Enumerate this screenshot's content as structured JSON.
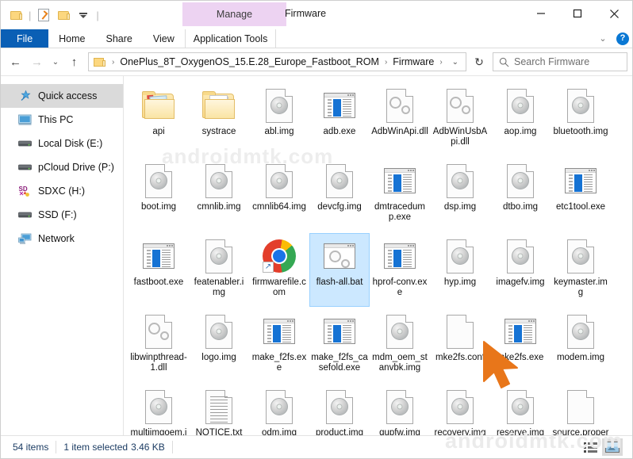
{
  "window": {
    "title": "Firmware",
    "context_tab": "Manage",
    "minimize_label": "Minimize",
    "maximize_label": "Maximize",
    "close_label": "Close"
  },
  "quick_access_toolbar": {
    "items": [
      {
        "name": "folder-icon",
        "label": "Customize Quick Access Toolbar"
      },
      {
        "name": "properties-icon",
        "label": "Properties"
      },
      {
        "name": "new-folder-icon",
        "label": "New folder"
      },
      {
        "name": "dropdown-icon",
        "label": "Customize"
      }
    ]
  },
  "ribbon": {
    "tabs": [
      {
        "label": "File",
        "id": "file"
      },
      {
        "label": "Home",
        "id": "home"
      },
      {
        "label": "Share",
        "id": "share"
      },
      {
        "label": "View",
        "id": "view"
      },
      {
        "label": "Application Tools",
        "id": "application-tools"
      }
    ],
    "collapse_icon": "chevron-down-icon",
    "help_icon": "?",
    "help_label": "Help"
  },
  "address_bar": {
    "back_icon": "←",
    "forward_icon": "→",
    "recent_icon": "⌄",
    "up_icon": "↑",
    "breadcrumbs": [
      "OnePlus_8T_OxygenOS_15.E.28_Europe_Fastboot_ROM",
      "Firmware"
    ],
    "breadcrumb_separator": "›",
    "dropdown_icon": "⌄",
    "refresh_icon": "↻",
    "refresh_label": "Refresh"
  },
  "search": {
    "placeholder": "Search Firmware",
    "icon": "search-icon"
  },
  "sidebar": {
    "items": [
      {
        "label": "Quick access",
        "icon": "star-pin-icon",
        "selected": true
      },
      {
        "label": "This PC",
        "icon": "monitor-icon",
        "selected": false
      },
      {
        "label": "Local Disk (E:)",
        "icon": "drive-icon",
        "selected": false
      },
      {
        "label": "pCloud Drive (P:)",
        "icon": "drive-icon",
        "selected": false
      },
      {
        "label": "SDXC (H:)",
        "icon": "sd-card-icon",
        "selected": false
      },
      {
        "label": "SSD (F:)",
        "icon": "drive-icon",
        "selected": false
      },
      {
        "label": "Network",
        "icon": "network-icon",
        "selected": false
      }
    ]
  },
  "files": [
    {
      "name": "api",
      "type": "folder-pictures",
      "selected": false
    },
    {
      "name": "systrace",
      "type": "folder-docs",
      "selected": false
    },
    {
      "name": "abl.img",
      "type": "disc",
      "selected": false
    },
    {
      "name": "adb.exe",
      "type": "app",
      "selected": false
    },
    {
      "name": "AdbWinApi.dll",
      "type": "dll",
      "selected": false
    },
    {
      "name": "AdbWinUsbApi.dll",
      "type": "dll",
      "selected": false
    },
    {
      "name": "aop.img",
      "type": "disc",
      "selected": false
    },
    {
      "name": "bluetooth.img",
      "type": "disc",
      "selected": false
    },
    {
      "name": "boot.img",
      "type": "disc",
      "selected": false
    },
    {
      "name": "cmnlib.img",
      "type": "disc",
      "selected": false
    },
    {
      "name": "cmnlib64.img",
      "type": "disc",
      "selected": false
    },
    {
      "name": "devcfg.img",
      "type": "disc",
      "selected": false
    },
    {
      "name": "dmtracedump.exe",
      "type": "app",
      "selected": false
    },
    {
      "name": "dsp.img",
      "type": "disc",
      "selected": false
    },
    {
      "name": "dtbo.img",
      "type": "disc",
      "selected": false
    },
    {
      "name": "etc1tool.exe",
      "type": "app",
      "selected": false
    },
    {
      "name": "fastboot.exe",
      "type": "app",
      "selected": false
    },
    {
      "name": "featenabler.img",
      "type": "disc",
      "selected": false
    },
    {
      "name": "firmwarefile.com",
      "type": "chrome-shortcut",
      "selected": false
    },
    {
      "name": "flash-all.bat",
      "type": "bat",
      "selected": true
    },
    {
      "name": "hprof-conv.exe",
      "type": "app",
      "selected": false
    },
    {
      "name": "hyp.img",
      "type": "disc",
      "selected": false
    },
    {
      "name": "imagefv.img",
      "type": "disc",
      "selected": false
    },
    {
      "name": "keymaster.img",
      "type": "disc",
      "selected": false
    },
    {
      "name": "libwinpthread-1.dll",
      "type": "dll",
      "selected": false
    },
    {
      "name": "logo.img",
      "type": "disc",
      "selected": false
    },
    {
      "name": "make_f2fs.exe",
      "type": "app",
      "selected": false
    },
    {
      "name": "make_f2fs_casefold.exe",
      "type": "app",
      "selected": false
    },
    {
      "name": "mdm_oem_stanvbk.img",
      "type": "disc",
      "selected": false
    },
    {
      "name": "mke2fs.conf",
      "type": "blank",
      "selected": false
    },
    {
      "name": "mke2fs.exe",
      "type": "app",
      "selected": false
    },
    {
      "name": "modem.img",
      "type": "disc",
      "selected": false
    },
    {
      "name": "multiimgoem.img",
      "type": "disc",
      "selected": false
    },
    {
      "name": "NOTICE.txt",
      "type": "text",
      "selected": false
    },
    {
      "name": "odm.img",
      "type": "disc",
      "selected": false
    },
    {
      "name": "product.img",
      "type": "disc",
      "selected": false
    },
    {
      "name": "qupfw.img",
      "type": "disc",
      "selected": false
    },
    {
      "name": "recovery.img",
      "type": "disc",
      "selected": false
    },
    {
      "name": "reserve.img",
      "type": "disc",
      "selected": false
    },
    {
      "name": "source.properties",
      "type": "blank",
      "selected": false
    }
  ],
  "status_bar": {
    "item_count": "54 items",
    "selection_count": "1 item selected",
    "selection_size": "3.46 KB",
    "views": [
      {
        "name": "details-view-button",
        "label": "Details view",
        "active": false
      },
      {
        "name": "large-icons-view-button",
        "label": "Large icons view",
        "active": true
      }
    ]
  },
  "watermarks": [
    "androidmtk.com",
    "androidmtk.com"
  ],
  "colors": {
    "file_tab": "#0a5fb5",
    "manage_context": "#edd3f2",
    "selection_fill": "#cce8ff",
    "selection_border": "#99d1ff",
    "cursor": "#e8761a",
    "status_text": "#1c3c63"
  }
}
